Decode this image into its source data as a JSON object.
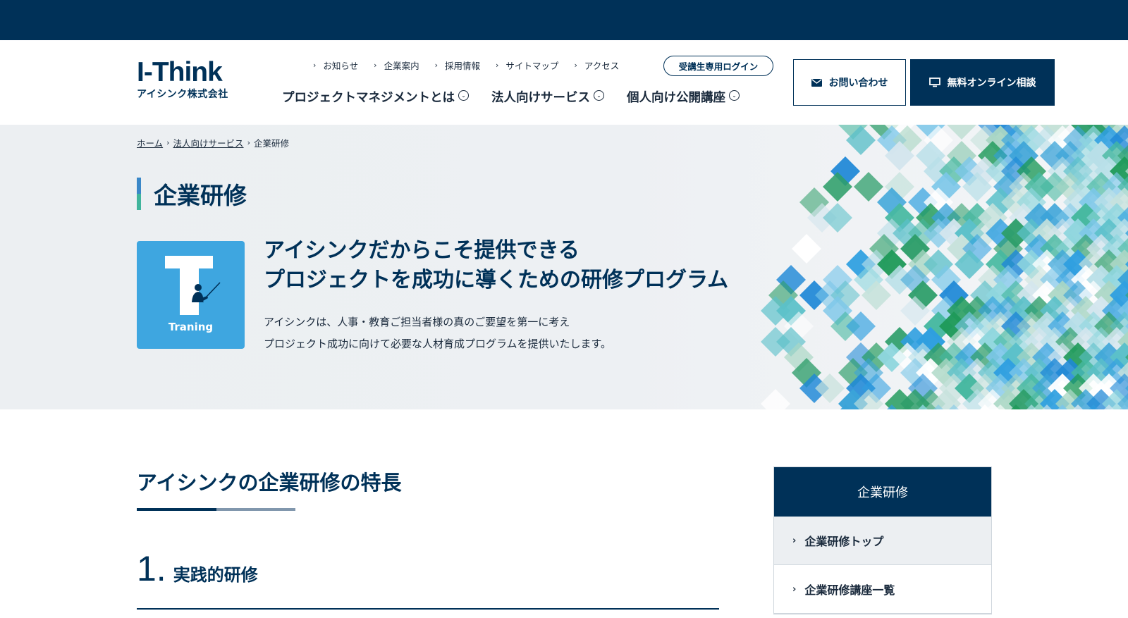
{
  "header": {
    "logo_main": "I-Think",
    "logo_sub": "アイシンク株式会社",
    "util_links": [
      "お知らせ",
      "企業案内",
      "採用情報",
      "サイトマップ",
      "アクセス"
    ],
    "login_label": "受講生専用ログイン",
    "main_nav": [
      "プロジェクトマネジメントとは",
      "法人向けサービス",
      "個人向け公開講座"
    ],
    "contact_label": "お問い合わせ",
    "consult_label": "無料オンライン相談"
  },
  "breadcrumb": {
    "home": "ホーム",
    "parent": "法人向けサービス",
    "current": "企業研修"
  },
  "hero": {
    "title": "企業研修",
    "card_label": "Traning",
    "headline_1": "アイシンクだからこそ提供できる",
    "headline_2": "プロジェクトを成功に導くための研修プログラム",
    "text_1": "アイシンクは、人事・教育ご担当者様の真のご要望を第一に考え",
    "text_2": "プロジェクト成功に向けて必要な人材育成プログラムを提供いたします。"
  },
  "main": {
    "section_title": "アイシンクの企業研修の特長",
    "feature_number": "1.",
    "feature_label": "実践的研修"
  },
  "sidebar": {
    "title": "企業研修",
    "items": [
      "企業研修トップ",
      "企業研修講座一覧"
    ]
  },
  "colors": {
    "navy": "#003158",
    "accent_blue": "#3ea6e0",
    "accent_green": "#40b49c"
  },
  "icons": {
    "mail": "envelope-icon",
    "monitor": "monitor-icon",
    "chevron": "chevron-right-icon",
    "caret": "chevron-down-circle-icon"
  }
}
